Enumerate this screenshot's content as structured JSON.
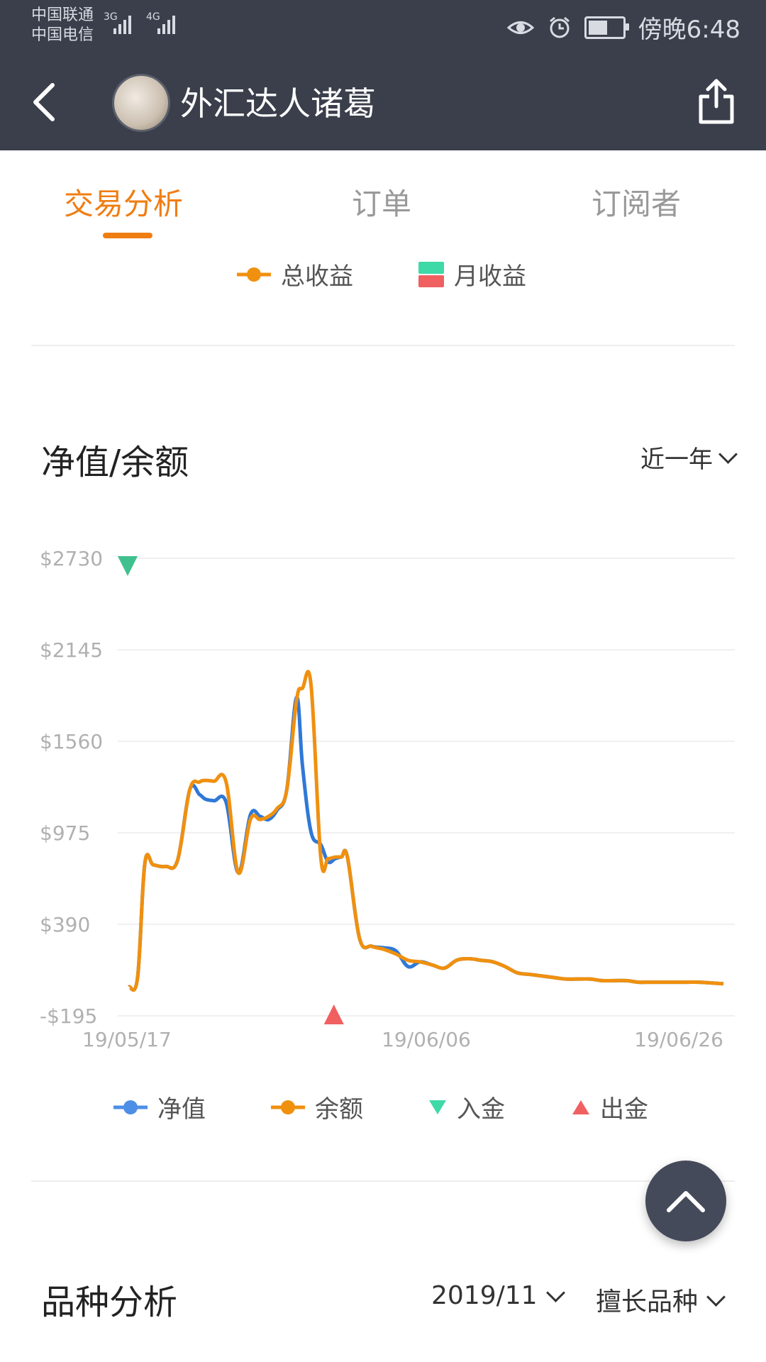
{
  "status_bar": {
    "carrier_1": "中国联通",
    "carrier_2": "中国电信",
    "net_1": "3G",
    "net_2": "4G",
    "time": "傍晚6:48"
  },
  "app_bar": {
    "title": "外汇达人诸葛"
  },
  "tabs": [
    {
      "label": "交易分析",
      "active": true
    },
    {
      "label": "订单",
      "active": false
    },
    {
      "label": "订阅者",
      "active": false
    }
  ],
  "top_legend": {
    "total": "总收益",
    "monthly": "月收益"
  },
  "section1": {
    "title": "净值/余额",
    "range": "近一年"
  },
  "colors": {
    "accent": "#f07d12",
    "equity": "#2f78d8",
    "balance": "#f0900f",
    "deposit": "#3fc08f",
    "withdraw": "#f06060",
    "monthly_green": "#3fd9a7",
    "monthly_red": "#f06060"
  },
  "chart_data": {
    "type": "line",
    "x_ticks": [
      "19/05/17",
      "19/06/06",
      "19/06/26"
    ],
    "y_ticks": [
      "$2730",
      "$2145",
      "$1560",
      "$975",
      "$390",
      "-$195"
    ],
    "ylim": [
      -195,
      2730
    ],
    "xlim": [
      0,
      49
    ],
    "series": [
      {
        "name": "净值",
        "color": "#2f78d8",
        "x": [
          0,
          0.7,
          1.3,
          2,
          3,
          4,
          5,
          5.8,
          6.3,
          7,
          8,
          9,
          10,
          10.8,
          11.5,
          12.2,
          13,
          13.8,
          14.3,
          15,
          15.8,
          16.4,
          17,
          17.5,
          18,
          19,
          20,
          21,
          22,
          23,
          24,
          25,
          26,
          27,
          28,
          29,
          30,
          31,
          32,
          33,
          34,
          35,
          36,
          37,
          38,
          39,
          40,
          41,
          42,
          43,
          44,
          45,
          46,
          47,
          48,
          49
        ],
        "values": [
          -10,
          50,
          780,
          770,
          760,
          800,
          1250,
          1220,
          1190,
          1180,
          1170,
          720,
          1090,
          1080,
          1060,
          1120,
          1250,
          1840,
          1400,
          980,
          900,
          790,
          810,
          820,
          820,
          300,
          250,
          240,
          220,
          120,
          150,
          130,
          110,
          160,
          170,
          160,
          150,
          120,
          80,
          70,
          60,
          50,
          40,
          40,
          40,
          30,
          30,
          30,
          20,
          20,
          20,
          20,
          20,
          20,
          15,
          10
        ]
      },
      {
        "name": "余额",
        "color": "#f0900f",
        "x": [
          0,
          0.7,
          1.3,
          2,
          3,
          4,
          5,
          5.8,
          6.3,
          7,
          8,
          9,
          10,
          10.8,
          11.5,
          12.2,
          13,
          13.8,
          14.3,
          15,
          15.8,
          16.4,
          17,
          17.5,
          18,
          19,
          20,
          21,
          22,
          23,
          24,
          25,
          26,
          27,
          28,
          29,
          30,
          31,
          32,
          33,
          34,
          35,
          36,
          37,
          38,
          39,
          40,
          41,
          42,
          43,
          44,
          45,
          46,
          47,
          48,
          49
        ],
        "values": [
          -10,
          50,
          780,
          770,
          760,
          800,
          1250,
          1300,
          1310,
          1305,
          1300,
          720,
          1060,
          1060,
          1080,
          1130,
          1250,
          1820,
          1900,
          1920,
          820,
          810,
          820,
          820,
          820,
          300,
          250,
          230,
          200,
          160,
          150,
          130,
          110,
          160,
          170,
          160,
          150,
          120,
          80,
          70,
          60,
          50,
          40,
          40,
          40,
          30,
          30,
          30,
          20,
          20,
          20,
          20,
          20,
          20,
          15,
          10
        ]
      }
    ],
    "markers": [
      {
        "type": "deposit",
        "x": 0,
        "y": 2680
      },
      {
        "type": "withdraw",
        "x": 17,
        "y": -195
      }
    ],
    "legend": [
      "净值",
      "余额",
      "入金",
      "出金"
    ],
    "grid": true
  },
  "section2": {
    "title": "品种分析",
    "month": "2019/11",
    "filter": "擅长品种"
  }
}
